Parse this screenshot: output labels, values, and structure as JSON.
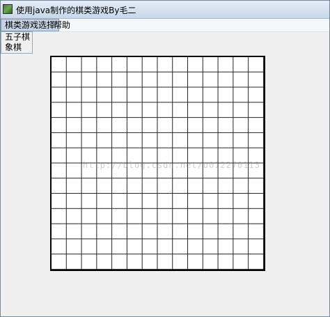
{
  "window": {
    "title": "使用java制作的棋类游戏By毛二"
  },
  "menubar": {
    "items": [
      {
        "label": "棋类游戏选择"
      },
      {
        "label": "帮助"
      }
    ]
  },
  "dropdown": {
    "items": [
      {
        "label": "五子棋"
      },
      {
        "label": "象棋"
      }
    ]
  },
  "board": {
    "rows": 14,
    "cols": 14,
    "background": "#ffffff",
    "line_color": "#222222"
  },
  "watermark": {
    "text": "http://blog.csdn.net/u012270113"
  }
}
